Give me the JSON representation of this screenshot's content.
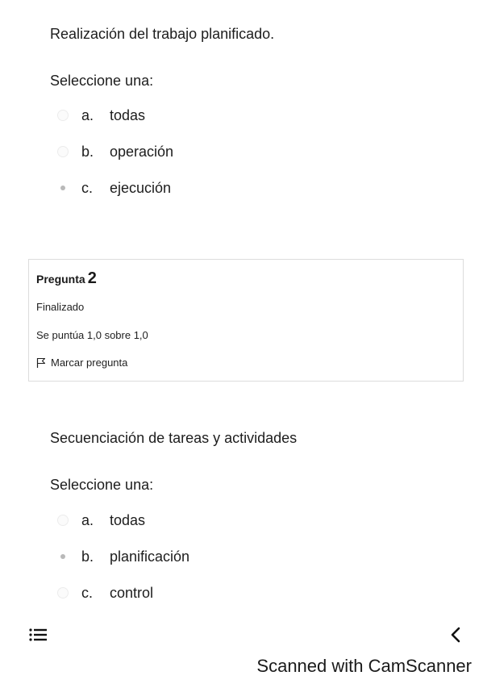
{
  "question1": {
    "text": "Realización del trabajo planificado.",
    "prompt": "Seleccione una:",
    "options": [
      {
        "letter": "a.",
        "text": "todas",
        "selected": false
      },
      {
        "letter": "b.",
        "text": "operación",
        "selected": false
      },
      {
        "letter": "c.",
        "text": "ejecución",
        "selected": true
      }
    ]
  },
  "info": {
    "title_label": "Pregunta",
    "number": "2",
    "status": "Finalizado",
    "score": "Se puntúa 1,0 sobre 1,0",
    "flag_label": "Marcar pregunta"
  },
  "question2": {
    "text": "Secuenciación de tareas y actividades",
    "prompt": "Seleccione una:",
    "options": [
      {
        "letter": "a.",
        "text": "todas",
        "selected": false
      },
      {
        "letter": "b.",
        "text": "planificación",
        "selected": true
      },
      {
        "letter": "c.",
        "text": "control",
        "selected": false
      }
    ]
  },
  "bottom_bar": {
    "menu_icon": "list-menu-icon",
    "back_icon": "chevron-left-icon"
  },
  "watermark": "Scanned with CamScanner"
}
